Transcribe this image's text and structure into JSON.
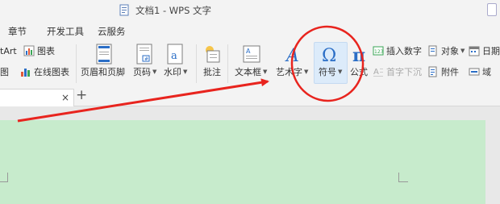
{
  "window": {
    "title": "文档1 - WPS 文字"
  },
  "menu": {
    "items": [
      "章节",
      "开发工具",
      "云服务"
    ]
  },
  "ribbon": {
    "smartart_label": "tArt",
    "chart_label": "图表",
    "left_cut_label": "图",
    "online_chart_label": "在线图表",
    "header_footer_label": "页眉和页脚",
    "page_number_label": "页码",
    "watermark_label": "水印",
    "comment_label": "批注",
    "textbox_label": "文本框",
    "wordart_label": "艺术字",
    "symbol_label": "符号",
    "equation_label": "公式",
    "insert_number_label": "插入数字",
    "object_label": "对象",
    "date_label": "日期",
    "drop_cap_label": "首字下沉",
    "attachment_label": "附件",
    "field_label": "域"
  },
  "tabs": {
    "close_glyph": "×",
    "add_glyph": "+"
  },
  "colors": {
    "page_bg": "#c7ebcc",
    "annotation_red": "#e8241e",
    "icon_blue": "#2b6ec6"
  }
}
